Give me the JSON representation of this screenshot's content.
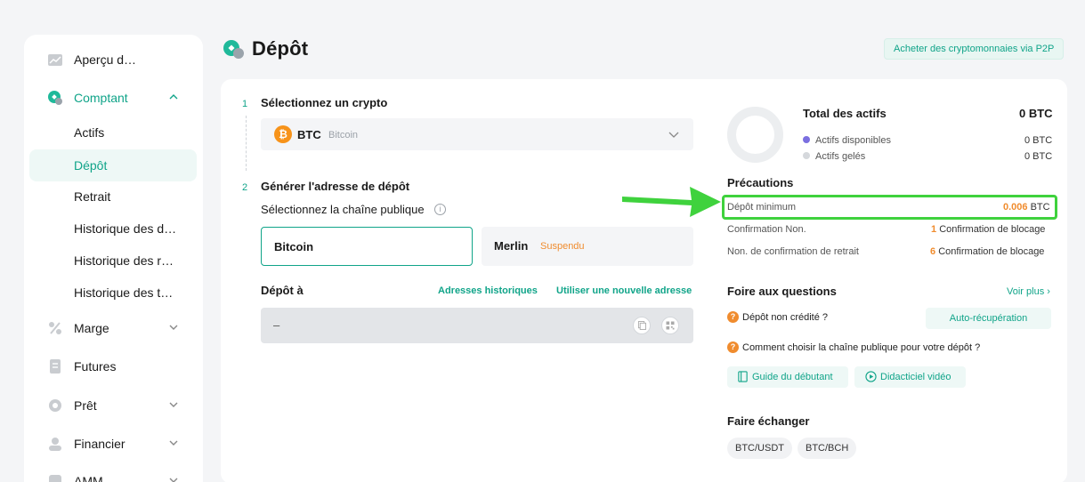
{
  "sidebar": {
    "items": [
      {
        "label": "Aperçu d…",
        "icon": "chart-icon"
      },
      {
        "label": "Comptant",
        "icon": "wallet-icon"
      },
      {
        "label": "Actifs"
      },
      {
        "label": "Dépôt"
      },
      {
        "label": "Retrait"
      },
      {
        "label": "Historique des d…"
      },
      {
        "label": "Historique des r…"
      },
      {
        "label": "Historique des t…"
      },
      {
        "label": "Marge",
        "icon": "percent-icon"
      },
      {
        "label": "Futures",
        "icon": "document-icon"
      },
      {
        "label": "Prêt",
        "icon": "loan-icon"
      },
      {
        "label": "Financier",
        "icon": "user-icon"
      },
      {
        "label": "AMM",
        "icon": "amm-icon"
      }
    ]
  },
  "header": {
    "title": "Dépôt",
    "p2p_button": "Acheter des cryptomonnaies via P2P"
  },
  "step1": {
    "number": "1",
    "title": "Sélectionnez un crypto",
    "selected_code": "BTC",
    "selected_name": "Bitcoin",
    "coin_symbol": "₿"
  },
  "step2": {
    "number": "2",
    "title": "Générer l'adresse de dépôt",
    "chain_label": "Sélectionnez la chaîne publique",
    "info_glyph": "i",
    "chains": [
      {
        "name": "Bitcoin",
        "status": ""
      },
      {
        "name": "Merlin",
        "status": "Suspendu"
      }
    ],
    "deposit_to_label": "Dépôt à",
    "history_link": "Adresses historiques",
    "new_address_link": "Utiliser une nouvelle adresse",
    "address_value": "–"
  },
  "assets": {
    "title": "Total des actifs",
    "total": "0 BTC",
    "available_label": "Actifs disponibles",
    "available_value": "0 BTC",
    "frozen_label": "Actifs gelés",
    "frozen_value": "0 BTC",
    "available_color": "#7b6fe0",
    "frozen_color": "#d5d8dc"
  },
  "precautions": {
    "title": "Précautions",
    "min_label": "Dépôt minimum",
    "min_amount": "0.006",
    "min_unit": "BTC",
    "conf_label": "Confirmation Non.",
    "conf_count": "1",
    "conf_suffix": "Confirmation de blocage",
    "withdraw_label": "Non. de confirmation de retrait",
    "withdraw_count": "6",
    "withdraw_suffix": "Confirmation de blocage"
  },
  "faq": {
    "title": "Foire aux questions",
    "more": "Voir plus",
    "q_glyph": "?",
    "q1": "Dépôt non crédité ?",
    "q1_button": "Auto-récupération",
    "q2": "Comment choisir la chaîne publique pour votre dépôt ?",
    "guide_button": "Guide du débutant",
    "video_button": "Didacticiel vidéo"
  },
  "exchange": {
    "title": "Faire échanger",
    "pairs": [
      "BTC/USDT",
      "BTC/BCH"
    ]
  },
  "colors": {
    "accent": "#10a489",
    "warning": "#f08c2e",
    "highlight": "#3fd23d"
  }
}
